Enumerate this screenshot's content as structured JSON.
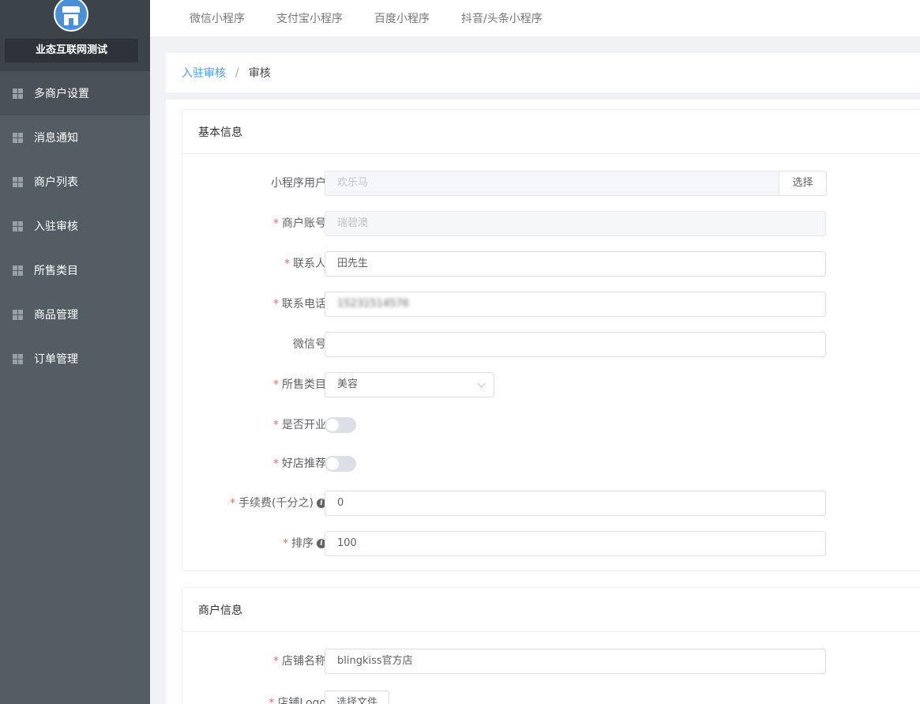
{
  "sidebar": {
    "brand_name": "业态互联网测试",
    "items": [
      {
        "label": "多商户设置"
      },
      {
        "label": "消息通知"
      },
      {
        "label": "商户列表"
      },
      {
        "label": "入驻审核"
      },
      {
        "label": "所售类目"
      },
      {
        "label": "商品管理"
      },
      {
        "label": "订单管理"
      }
    ]
  },
  "topnav": {
    "tabs": [
      "微信小程序",
      "支付宝小程序",
      "百度小程序",
      "抖音/头条小程序"
    ]
  },
  "breadcrumb": {
    "parent": "入驻审核",
    "separator": "/",
    "current": "审核"
  },
  "basic": {
    "title": "基本信息",
    "mini_user_label": "小程序用户",
    "mini_user_value": "欢乐马",
    "select_button": "选择",
    "account_label": "商户账号",
    "account_value": "瑞碧澳",
    "contact_label": "联系人",
    "contact_value": "田先生",
    "phone_label": "联系电话",
    "phone_value": "15231514576",
    "wechat_label": "微信号",
    "wechat_value": "",
    "category_label": "所售类目",
    "category_value": "美容",
    "open_label": "是否开业",
    "open_on": false,
    "recommend_label": "好店推荐",
    "recommend_on": false,
    "fee_label": "手续费(千分之)",
    "fee_value": "0",
    "sort_label": "排序",
    "sort_value": "100"
  },
  "merchant": {
    "title": "商户信息",
    "shop_name_label": "店铺名称",
    "shop_name_value": "blingkiss官方店",
    "logo_label": "店铺Logo",
    "choose_file": "选择文件"
  },
  "colors": {
    "sidebar_bg": "#545c64",
    "link": "#409eff",
    "required_star": "#f56c6c"
  }
}
